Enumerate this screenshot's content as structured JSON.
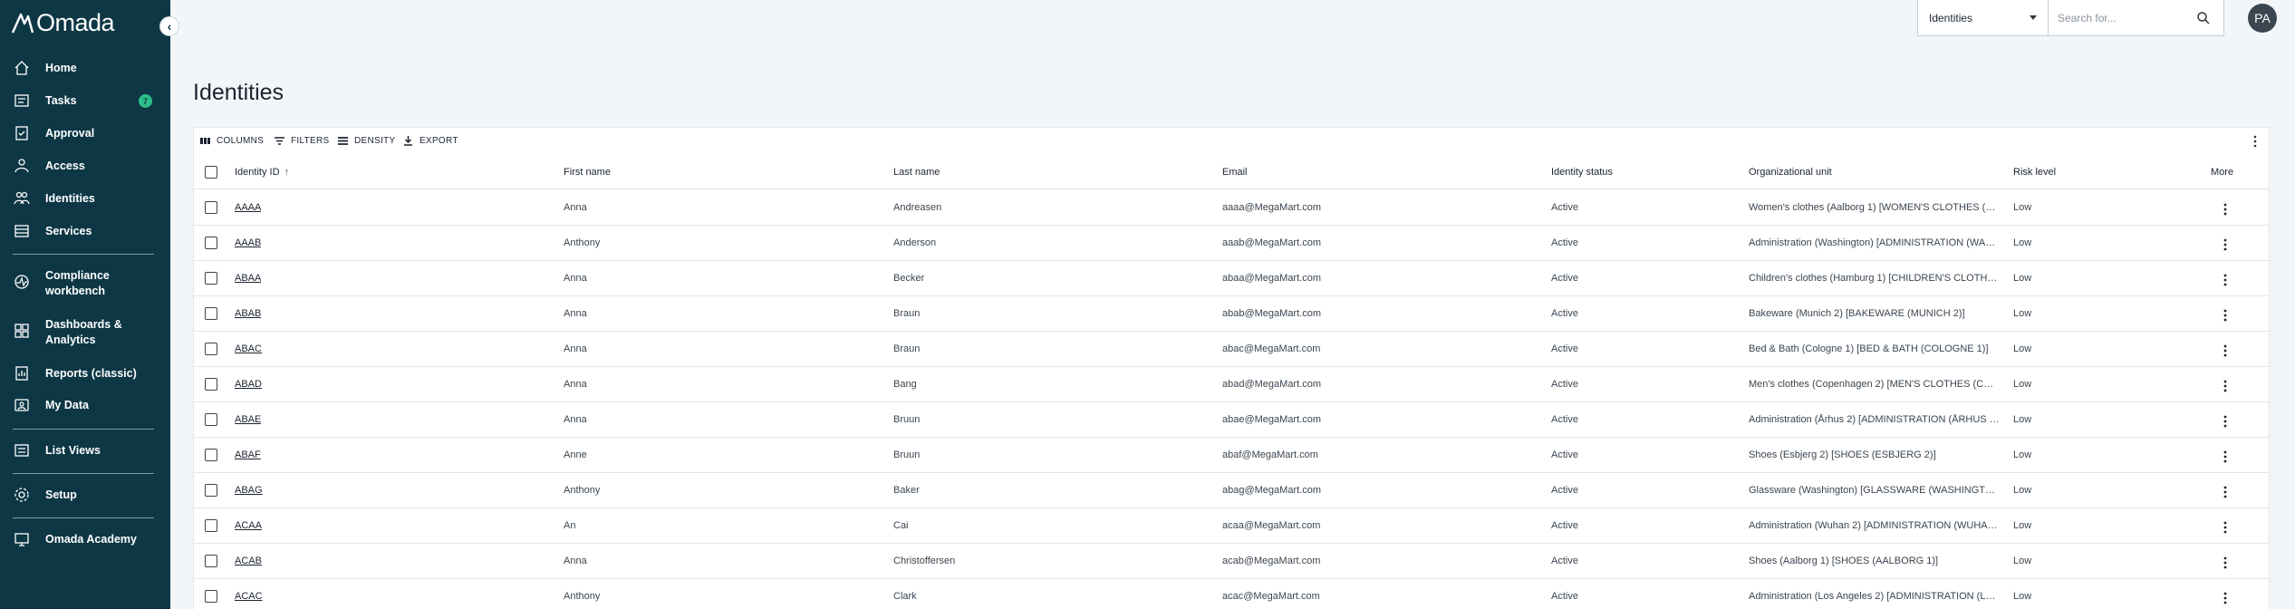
{
  "brand": {
    "name": "Omada",
    "sidebar_bg": "#0d3745",
    "accent": "#2fbf8a"
  },
  "sidebar": {
    "collapse_icon": "chevron-left-icon",
    "items": [
      {
        "label": "Home",
        "icon": "home-icon"
      },
      {
        "label": "Tasks",
        "icon": "tasks-icon",
        "badge": "7"
      },
      {
        "label": "Approval",
        "icon": "approval-icon"
      },
      {
        "label": "Access",
        "icon": "access-icon"
      },
      {
        "label": "Identities",
        "icon": "identities-icon"
      },
      {
        "label": "Services",
        "icon": "services-icon"
      },
      {
        "label": "Compliance workbench",
        "icon": "compliance-icon"
      },
      {
        "label": "Dashboards & Analytics",
        "icon": "dashboards-icon"
      },
      {
        "label": "Reports (classic)",
        "icon": "reports-icon"
      },
      {
        "label": "My Data",
        "icon": "my-data-icon"
      },
      {
        "label": "List Views",
        "icon": "list-views-icon"
      },
      {
        "label": "Setup",
        "icon": "gear-icon"
      },
      {
        "label": "Omada Academy",
        "icon": "academy-icon"
      }
    ]
  },
  "topbar": {
    "search_scope": "Identities",
    "search_placeholder": "Search for...",
    "avatar_initials": "PA"
  },
  "page": {
    "title": "Identities"
  },
  "toolbar": {
    "columns": "COLUMNS",
    "filters": "FILTERS",
    "density": "DENSITY",
    "export": "EXPORT"
  },
  "table": {
    "headers": {
      "id": "Identity ID",
      "first": "First name",
      "last": "Last name",
      "email": "Email",
      "status": "Identity status",
      "org": "Organizational unit",
      "risk": "Risk level",
      "more": "More"
    },
    "rows": [
      {
        "id": "AAAA",
        "first": "Anna",
        "last": "Andreasen",
        "email": "aaaa@MegaMart.com",
        "status": "Active",
        "org": "Women's clothes (Aalborg 1) [WOMEN'S CLOTHES (AA...",
        "risk": "Low"
      },
      {
        "id": "AAAB",
        "first": "Anthony",
        "last": "Anderson",
        "email": "aaab@MegaMart.com",
        "status": "Active",
        "org": "Administration (Washington) [ADMINISTRATION (WAS...",
        "risk": "Low"
      },
      {
        "id": "ABAA",
        "first": "Anna",
        "last": "Becker",
        "email": "abaa@MegaMart.com",
        "status": "Active",
        "org": "Children's clothes (Hamburg 1) [CHILDREN'S CLOTHES ...",
        "risk": "Low"
      },
      {
        "id": "ABAB",
        "first": "Anna",
        "last": "Braun",
        "email": "abab@MegaMart.com",
        "status": "Active",
        "org": "Bakeware (Munich 2) [BAKEWARE (MUNICH 2)]",
        "risk": "Low"
      },
      {
        "id": "ABAC",
        "first": "Anna",
        "last": "Braun",
        "email": "abac@MegaMart.com",
        "status": "Active",
        "org": "Bed & Bath (Cologne 1) [BED & BATH (COLOGNE 1)]",
        "risk": "Low"
      },
      {
        "id": "ABAD",
        "first": "Anna",
        "last": "Bang",
        "email": "abad@MegaMart.com",
        "status": "Active",
        "org": "Men's clothes (Copenhagen 2) [MEN'S CLOTHES (COPE...",
        "risk": "Low"
      },
      {
        "id": "ABAE",
        "first": "Anna",
        "last": "Bruun",
        "email": "abae@MegaMart.com",
        "status": "Active",
        "org": "Administration (Århus 2) [ADMINISTRATION (ÅRHUS 2)]",
        "risk": "Low"
      },
      {
        "id": "ABAF",
        "first": "Anne",
        "last": "Bruun",
        "email": "abaf@MegaMart.com",
        "status": "Active",
        "org": "Shoes (Esbjerg 2) [SHOES (ESBJERG 2)]",
        "risk": "Low"
      },
      {
        "id": "ABAG",
        "first": "Anthony",
        "last": "Baker",
        "email": "abag@MegaMart.com",
        "status": "Active",
        "org": "Glassware (Washington) [GLASSWARE (WASHINGTON)]",
        "risk": "Low"
      },
      {
        "id": "ACAA",
        "first": "An",
        "last": "Cai",
        "email": "acaa@MegaMart.com",
        "status": "Active",
        "org": "Administration (Wuhan 2) [ADMINISTRATION (WUHAN...",
        "risk": "Low"
      },
      {
        "id": "ACAB",
        "first": "Anna",
        "last": "Christoffersen",
        "email": "acab@MegaMart.com",
        "status": "Active",
        "org": "Shoes (Aalborg 1) [SHOES (AALBORG 1)]",
        "risk": "Low"
      },
      {
        "id": "ACAC",
        "first": "Anthony",
        "last": "Clark",
        "email": "acac@MegaMart.com",
        "status": "Active",
        "org": "Administration (Los Angeles 2) [ADMINISTRATION (LO...",
        "risk": "Low"
      }
    ]
  }
}
